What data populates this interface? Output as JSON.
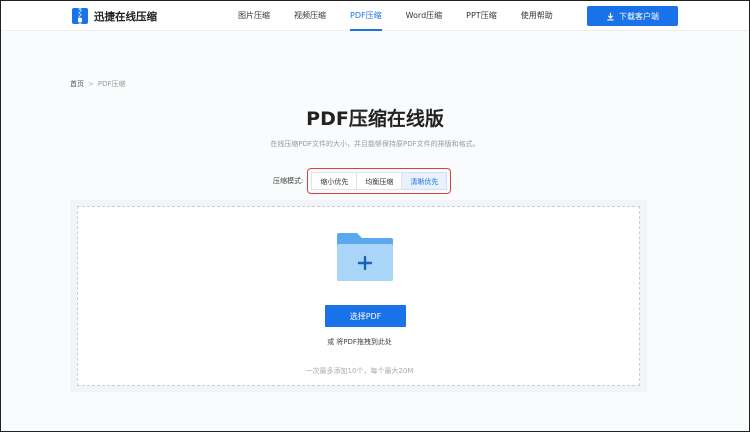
{
  "header": {
    "logo_text": "迅捷在线压缩",
    "nav": [
      {
        "label": "图片压缩",
        "active": false
      },
      {
        "label": "视频压缩",
        "active": false
      },
      {
        "label": "PDF压缩",
        "active": true
      },
      {
        "label": "Word压缩",
        "active": false
      },
      {
        "label": "PPT压缩",
        "active": false
      },
      {
        "label": "使用帮助",
        "active": false
      }
    ],
    "download_label": "下载客户端"
  },
  "breadcrumb": {
    "home": "首页",
    "separator": ">",
    "current": "PDF压缩"
  },
  "main": {
    "title": "PDF压缩在线版",
    "subtitle": "在线压缩PDF文件的大小，并且能够保持原PDF文件的排版和格式。",
    "mode": {
      "label": "压缩模式:",
      "options": [
        {
          "label": "缩小优先",
          "selected": false
        },
        {
          "label": "均衡压缩",
          "selected": false
        },
        {
          "label": "清晰优先",
          "selected": true
        }
      ]
    },
    "upload": {
      "button_label": "选择PDF",
      "drag_hint": "或 将PDF拖拽到此处",
      "limit_hint": "一次最多添加10个，每个最大20M"
    }
  },
  "colors": {
    "accent": "#1a72e8",
    "highlight_border": "#d9443a",
    "folder_back": "#5aa8ee",
    "folder_front": "#a9d6f8"
  },
  "icons": {
    "logo": "zipper-file-icon",
    "download": "download-arrow-icon",
    "folder": "folder-plus-icon"
  }
}
